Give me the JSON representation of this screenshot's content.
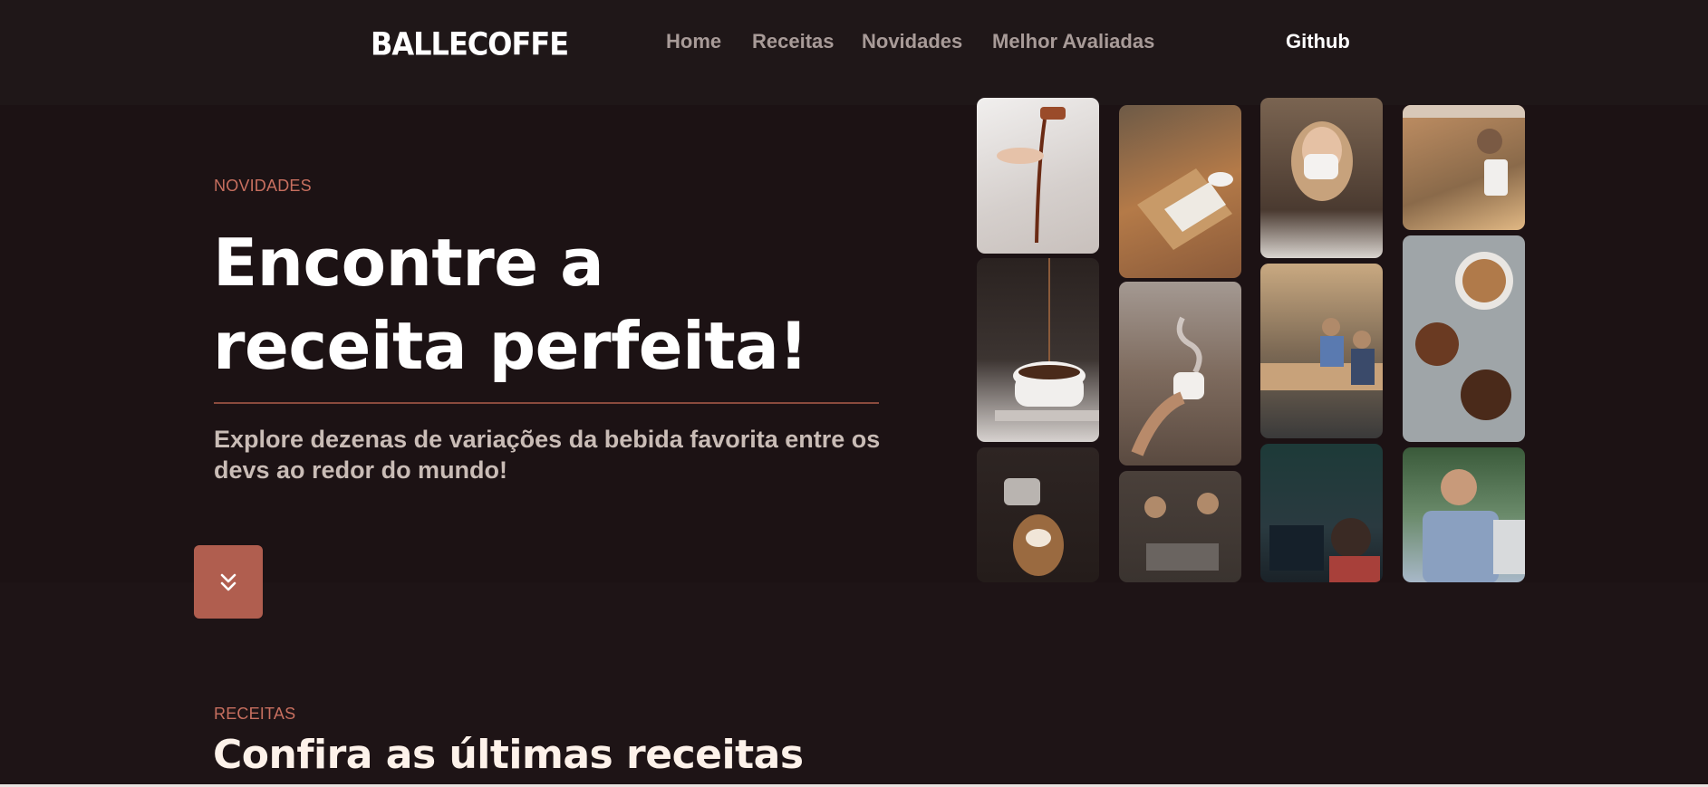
{
  "header": {
    "logo": "BALLECOFFE",
    "nav": [
      {
        "label": "Home"
      },
      {
        "label": "Receitas"
      },
      {
        "label": "Novidades"
      },
      {
        "label": "Melhor Avaliadas"
      }
    ],
    "github_label": "Github"
  },
  "hero": {
    "eyebrow": "NOVIDADES",
    "title_line1": "Encontre a",
    "title_line2": "receita perfeita!",
    "subtitle": "Explore dezenas de variações da bebida favorita entre os devs ao redor do mundo!",
    "scroll_button_icon": "double-chevron-down-icon"
  },
  "gallery": {
    "photos": [
      {
        "subject": "coffee-pour-hand",
        "color": "#d8d2cf"
      },
      {
        "subject": "coffee-drip-cup",
        "color": "#3a3230"
      },
      {
        "subject": "latte-art-pour",
        "color": "#2b2220"
      },
      {
        "subject": "table-notebook-coffee",
        "color": "#8a5a3a"
      },
      {
        "subject": "hand-cup-steam",
        "color": "#8e7f74"
      },
      {
        "subject": "baristas-working",
        "color": "#3e3834"
      },
      {
        "subject": "woman-drinking-coffee",
        "color": "#5b4a3f"
      },
      {
        "subject": "office-team-meeting",
        "color": "#7d6a55"
      },
      {
        "subject": "developer-at-screen",
        "color": "#1f3a38"
      },
      {
        "subject": "barista-espresso-machine",
        "color": "#a87a4a"
      },
      {
        "subject": "cappuccino-beans-topview",
        "color": "#a9aeb0"
      },
      {
        "subject": "smiling-man-laptop",
        "color": "#506a4a"
      }
    ]
  },
  "recipes_section": {
    "eyebrow": "RECEITAS",
    "title": "Confira as últimas receitas"
  }
}
